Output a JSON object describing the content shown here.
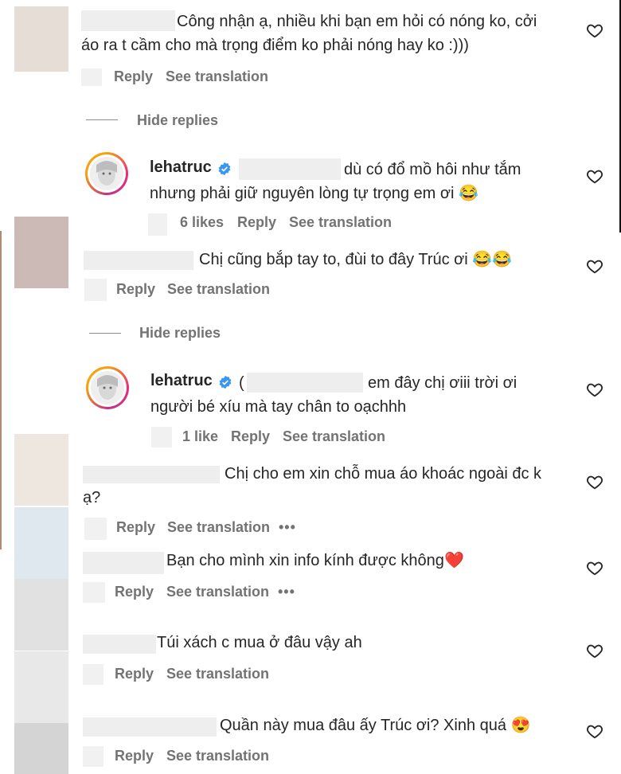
{
  "comments": [
    {
      "line1": "Công nhận ạ, nhiều khi bạn em hỏi có nóng ko, cởi",
      "line2": "áo ra t cầm cho mà trọng điểm ko phải nóng hay ko :)))",
      "reply": "Reply",
      "see_translation": "See translation"
    },
    {
      "hide_replies": "Hide replies"
    },
    {
      "username": "lehatruc",
      "line1": "dù có đổ mồ hôi như tắm",
      "line2": "nhưng phải giữ nguyên lòng tự trọng em ơi",
      "emoji": "😂",
      "likes": "6 likes",
      "reply": "Reply",
      "see_translation": "See translation"
    },
    {
      "line1": "Chị cũng bắp tay to, đùi to đây Trúc ơi",
      "emoji": "😂😂",
      "reply": "Reply",
      "see_translation": "See translation"
    },
    {
      "hide_replies": "Hide replies"
    },
    {
      "username": "lehatruc",
      "prefix": "(",
      "line1": "em đây chị ơiii trời ơi",
      "line2": "người bé xíu mà tay chân to oạchhh",
      "likes": "1 like",
      "reply": "Reply",
      "see_translation": "See translation"
    },
    {
      "line1": "Chị cho em xin chỗ mua áo khoác ngoài đc k",
      "line2": "ạ?",
      "reply": "Reply",
      "see_translation": "See translation",
      "more": "•••"
    },
    {
      "line1": "Bạn cho mình xin info kính được không",
      "emoji": "❤️",
      "reply": "Reply",
      "see_translation": "See translation",
      "more": "•••"
    },
    {
      "line1": "Túi xách c mua ở đâu vậy ah",
      "reply": "Reply",
      "see_translation": "See translation"
    },
    {
      "line1": "Quần này mua đâu ấy Trúc ơi? Xinh quá",
      "emoji": "😍",
      "reply": "Reply",
      "see_translation": "See translation"
    }
  ],
  "colors": {
    "text": "#262626",
    "meta": "#737373",
    "verified": "#3897f0",
    "heart_stroke": "#262626"
  },
  "icons": {
    "like": "heart-outline-icon",
    "verified": "verified-badge-icon",
    "more": "more-dots-icon"
  }
}
